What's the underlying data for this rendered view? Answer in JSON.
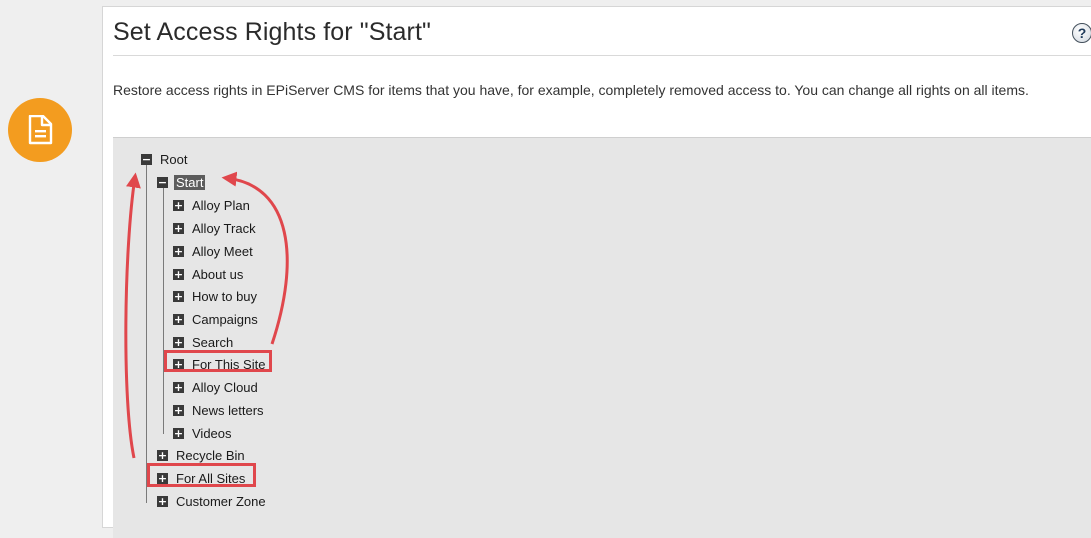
{
  "page": {
    "title": "Set Access Rights for \"Start\"",
    "help_label": "?",
    "description": "Restore access rights in EPiServer CMS for items that you have, for example, completely removed access to. You can change all rights on all items."
  },
  "badge": {
    "icon": "document-icon",
    "color": "#f39c1f"
  },
  "tree": {
    "root": {
      "label": "Root",
      "toggle": "−"
    },
    "start": {
      "label": "Start",
      "toggle": "−"
    },
    "start_children": [
      {
        "label": "Alloy Plan",
        "toggle": "+"
      },
      {
        "label": "Alloy Track",
        "toggle": "+"
      },
      {
        "label": "Alloy Meet",
        "toggle": "+"
      },
      {
        "label": "About us",
        "toggle": "+"
      },
      {
        "label": "How to buy",
        "toggle": "+"
      },
      {
        "label": "Campaigns",
        "toggle": "+"
      },
      {
        "label": "Search",
        "toggle": "+"
      },
      {
        "label": "For This Site",
        "toggle": "+"
      },
      {
        "label": "Alloy Cloud",
        "toggle": "+"
      },
      {
        "label": "News letters",
        "toggle": "+"
      },
      {
        "label": "Videos",
        "toggle": "+"
      }
    ],
    "root_children": [
      {
        "label": "Recycle Bin",
        "toggle": "+"
      },
      {
        "label": "For All Sites",
        "toggle": "+"
      },
      {
        "label": "Customer Zone",
        "toggle": "+"
      }
    ]
  },
  "annotation": {
    "color": "#e0474c"
  }
}
